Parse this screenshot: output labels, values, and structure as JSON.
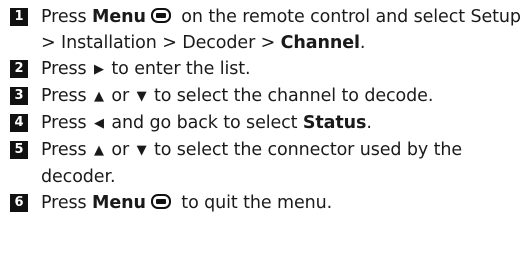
{
  "steps": [
    {
      "number": "1",
      "parts": {
        "a": "Press ",
        "menu": "Menu",
        "b": " on the remote control and select Setup > Installation > Decoder > ",
        "channel": "Channel",
        "c": "."
      }
    },
    {
      "number": "2",
      "parts": {
        "a": "Press ",
        "arrow": "▶",
        "b": " to enter the list."
      }
    },
    {
      "number": "3",
      "parts": {
        "a": "Press ",
        "up": "▲",
        "b": " or ",
        "down": "▼",
        "c": " to select the channel to decode."
      }
    },
    {
      "number": "4",
      "parts": {
        "a": "Press ",
        "arrow": "◀",
        "b": " and go back to select ",
        "status": "Status",
        "c": "."
      }
    },
    {
      "number": "5",
      "parts": {
        "a": "Press ",
        "up": "▲",
        "b": " or ",
        "down": "▼",
        "c": " to select the connector used by the decoder."
      }
    },
    {
      "number": "6",
      "parts": {
        "a": "Press ",
        "menu": "Menu",
        "b": " to quit the menu."
      }
    }
  ]
}
